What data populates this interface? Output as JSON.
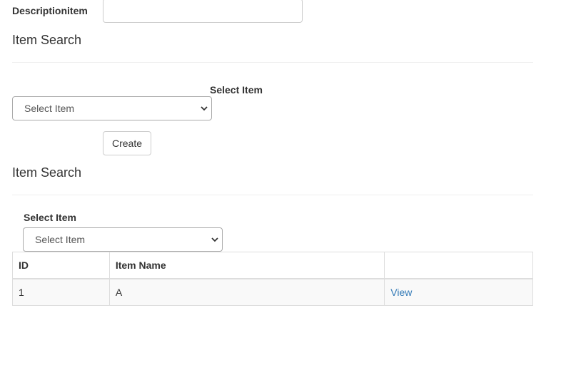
{
  "description_field": {
    "label": "Descriptionitem",
    "value": "",
    "placeholder": ""
  },
  "section1": {
    "title": "Item Search",
    "select_label": "Select Item",
    "select_value": "Select Item",
    "create_label": "Create"
  },
  "section2": {
    "title": "Item Search",
    "select_label": "Select Item",
    "select_value": "Select Item"
  },
  "table": {
    "headers": [
      "ID",
      "Item Name",
      ""
    ],
    "rows": [
      {
        "id": "1",
        "name": "A",
        "action": "View"
      }
    ]
  },
  "colors": {
    "link": "#337ab7",
    "border": "#dddddd",
    "row_stripe": "#f9f9f9"
  }
}
